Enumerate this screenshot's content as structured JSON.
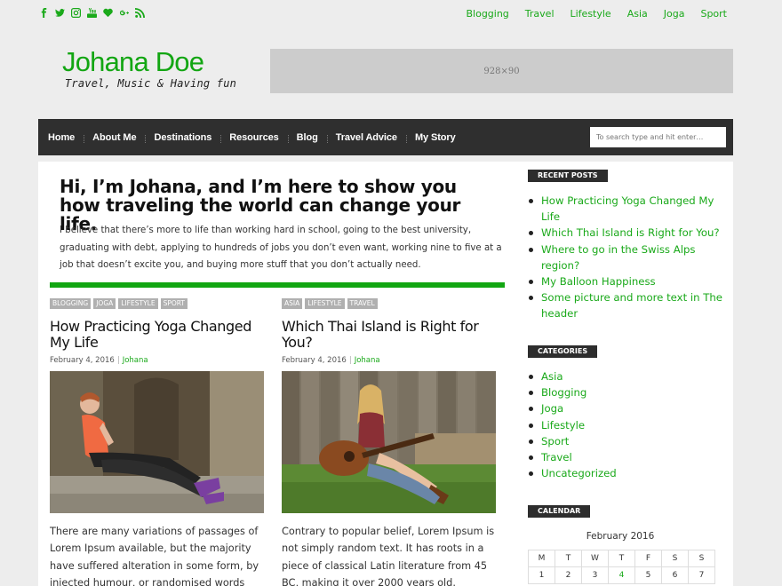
{
  "topbar": {
    "social": [
      "facebook-icon",
      "twitter-icon",
      "instagram-icon",
      "youtube-icon",
      "heart-icon",
      "google-plus-icon",
      "rss-icon"
    ],
    "nav": [
      "Blogging",
      "Travel",
      "Lifestyle",
      "Asia",
      "Joga",
      "Sport"
    ]
  },
  "header": {
    "title": "Johana Doe",
    "tagline": "Travel, Music & Having fun",
    "ad": "928×90"
  },
  "mainnav": {
    "items": [
      "Home",
      "About Me",
      "Destinations",
      "Resources",
      "Blog",
      "Travel Advice",
      "My Story"
    ],
    "search_placeholder": "To search type and hit enter…"
  },
  "intro": {
    "heading": "Hi, I’m Johana, and I’m here to show you how traveling the world can change your life.",
    "text": "I believe that there’s more to life than working hard in school, going to the best university, graduating with debt, applying to hundreds of jobs you don’t even want, working nine to five at a job that doesn’t excite you, and buying more stuff that you don’t actually need."
  },
  "posts": [
    {
      "tags": [
        "Blogging",
        "Joga",
        "Lifestyle",
        "Sport"
      ],
      "title": "How Practicing Yoga Changed My Life",
      "date": "February 4, 2016",
      "author": "Johana",
      "excerpt": "There are many variations of passages of Lorem Ipsum available, but the majority have suffered alteration in some form, by injected humour, or randomised words"
    },
    {
      "tags": [
        "Asia",
        "Lifestyle",
        "Travel"
      ],
      "title": "Which Thai Island is Right for You?",
      "date": "February 4, 2016",
      "author": "Johana",
      "excerpt": "Contrary to popular belief, Lorem Ipsum is not simply random text. It has roots in a piece of classical Latin literature from 45 BC, making it over 2000 years old. Richard"
    }
  ],
  "sidebar": {
    "recent_title": "RECENT POSTS",
    "recent": [
      "How Practicing Yoga Changed My Life",
      "Which Thai Island is Right for You?",
      "Where to go in the Swiss Alps region?",
      "My Balloon Happiness",
      "Some picture and more text in The header"
    ],
    "categories_title": "CATEGORIES",
    "categories": [
      "Asia",
      "Blogging",
      "Joga",
      "Lifestyle",
      "Sport",
      "Travel",
      "Uncategorized"
    ],
    "calendar_title": "CALENDAR",
    "calendar_caption": "February 2016",
    "calendar_days": [
      "M",
      "T",
      "W",
      "T",
      "F",
      "S",
      "S"
    ],
    "calendar_row1": [
      "1",
      "2",
      "3",
      "4",
      "5",
      "6",
      "7"
    ]
  },
  "colors": {
    "accent": "#1aa91a",
    "nav_bg": "#2f2f2f",
    "ad_bg": "#cccccc"
  }
}
